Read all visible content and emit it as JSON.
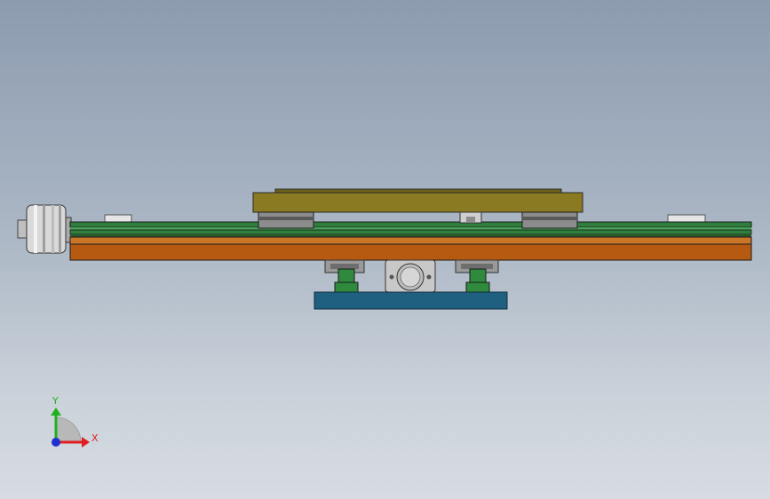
{
  "view": {
    "title": "",
    "background_top": "#8d9bb0",
    "background_bottom": "#d7dce2"
  },
  "colors": {
    "carriage_plate": "#8a7a22",
    "carriage_plate_dark": "#5e5416",
    "rail_green": "#2f7f3c",
    "rail_green_light": "#4aa058",
    "base_orange": "#b55a10",
    "base_orange_light": "#c97426",
    "mount_blue": "#1f6080",
    "bearing_gray": "#8c8c8c",
    "motor_silver": "#d8d8d8",
    "axis_x": "#e02020",
    "axis_y": "#20b020",
    "axis_z": "#2030d0"
  },
  "triad": {
    "x_label": "X",
    "y_label": "Y"
  }
}
